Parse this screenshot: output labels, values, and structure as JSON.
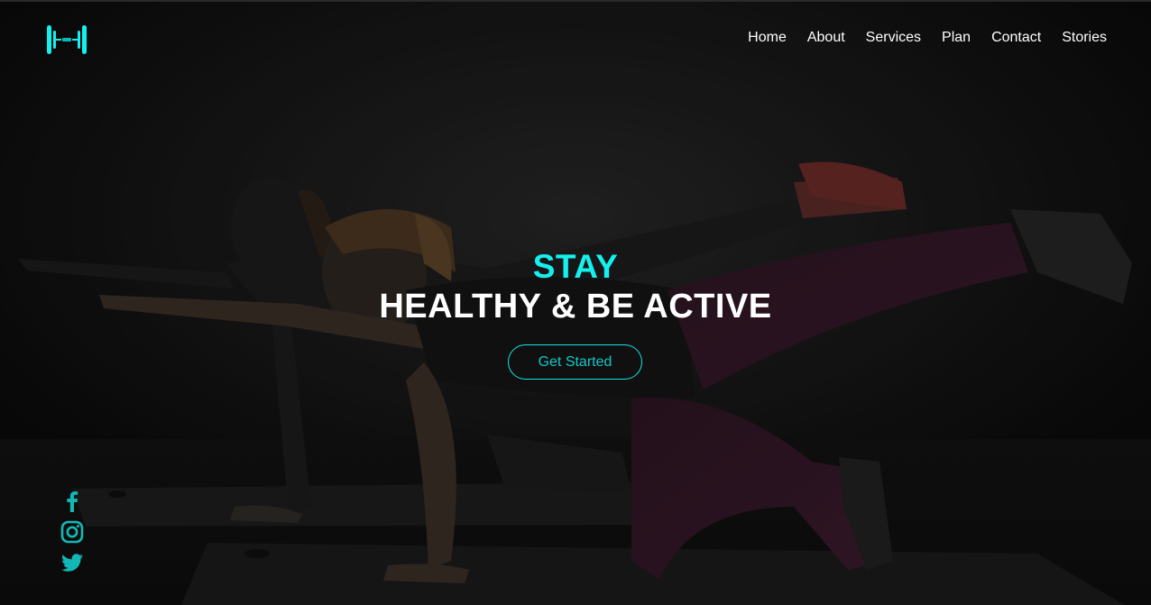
{
  "brand": {
    "logo_icon": "dumbbell-icon",
    "accent_color": "#14f0ee"
  },
  "nav": {
    "items": [
      {
        "label": "Home"
      },
      {
        "label": "About"
      },
      {
        "label": "Services"
      },
      {
        "label": "Plan"
      },
      {
        "label": "Contact"
      },
      {
        "label": "Stories"
      }
    ]
  },
  "hero": {
    "headline_accent": "STAY",
    "headline_main": "HEALTHY & BE ACTIVE",
    "cta_label": "Get Started",
    "background": "two women doing bird-dog exercise on mats"
  },
  "social": {
    "icons": [
      "facebook-icon",
      "instagram-icon",
      "twitter-icon"
    ],
    "color": "#13b8b6"
  }
}
